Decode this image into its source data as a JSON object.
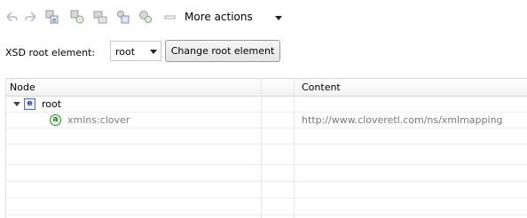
{
  "toolbar": {
    "icons": [
      "undo-icon",
      "redo-icon",
      "add-child-element-icon",
      "add-child-attribute-icon",
      "add-wrapper-icon",
      "add-sibling-icon",
      "add-sibling-attribute-icon",
      "remove-icon"
    ],
    "more_actions_label": "More actions"
  },
  "root_element": {
    "label": "XSD root element:",
    "selected": "root",
    "change_button_label": "Change root element"
  },
  "table": {
    "columns": [
      "Node",
      "Content"
    ],
    "rows": [
      {
        "badge": "e",
        "node": "root",
        "content": ""
      },
      {
        "badge": "a",
        "node": "xmlns:clover",
        "content": "http://www.cloveretl.com/ns/xmlmapping"
      }
    ]
  },
  "colors": {
    "element_badge": "#4a6fb5",
    "attribute_badge": "#2f8a2f",
    "gray_text": "#7a7a7a"
  }
}
